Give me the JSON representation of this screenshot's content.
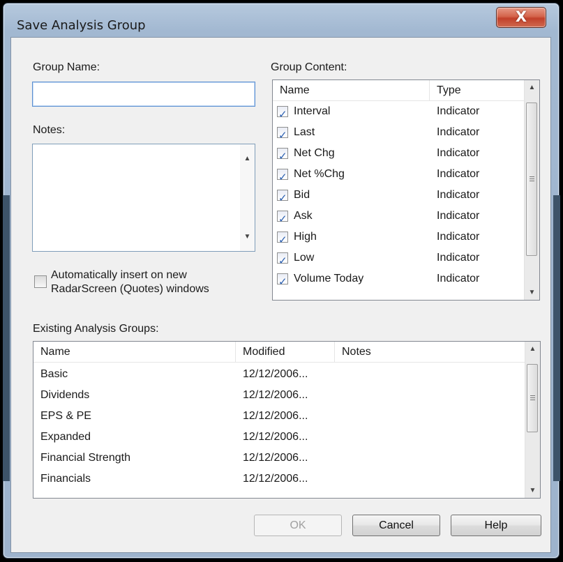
{
  "window": {
    "title": "Save Analysis Group",
    "close_label": "X"
  },
  "form": {
    "group_name_label": "Group Name:",
    "group_name_value": "",
    "notes_label": "Notes:",
    "notes_value": "",
    "auto_insert_line1": "Automatically insert on new",
    "auto_insert_line2": "RadarScreen (Quotes) windows",
    "auto_insert_checked": false
  },
  "group_content": {
    "label": "Group Content:",
    "columns": [
      "Name",
      "Type"
    ],
    "items": [
      {
        "name": "Interval",
        "type": "Indicator",
        "checked": true
      },
      {
        "name": "Last",
        "type": "Indicator",
        "checked": true
      },
      {
        "name": "Net Chg",
        "type": "Indicator",
        "checked": true
      },
      {
        "name": "Net %Chg",
        "type": "Indicator",
        "checked": true
      },
      {
        "name": "Bid",
        "type": "Indicator",
        "checked": true
      },
      {
        "name": "Ask",
        "type": "Indicator",
        "checked": true
      },
      {
        "name": "High",
        "type": "Indicator",
        "checked": true
      },
      {
        "name": "Low",
        "type": "Indicator",
        "checked": true
      },
      {
        "name": "Volume Today",
        "type": "Indicator",
        "checked": true
      }
    ]
  },
  "existing_groups": {
    "label": "Existing Analysis Groups:",
    "columns": [
      "Name",
      "Modified",
      "Notes"
    ],
    "rows": [
      {
        "name": "Basic",
        "modified": "12/12/2006...",
        "notes": ""
      },
      {
        "name": "Dividends",
        "modified": "12/12/2006...",
        "notes": ""
      },
      {
        "name": "EPS & PE",
        "modified": "12/12/2006...",
        "notes": ""
      },
      {
        "name": "Expanded",
        "modified": "12/12/2006...",
        "notes": ""
      },
      {
        "name": "Financial Strength",
        "modified": "12/12/2006...",
        "notes": ""
      },
      {
        "name": "Financials",
        "modified": "12/12/2006...",
        "notes": ""
      }
    ]
  },
  "buttons": {
    "ok": "OK",
    "cancel": "Cancel",
    "help": "Help"
  },
  "icons": {
    "scroll_up": "scroll-up-arrow",
    "scroll_down": "scroll-down-arrow",
    "checkmark": "checkmark",
    "close": "close-x"
  },
  "colors": {
    "close_button": "#c2402a",
    "checkmark": "#2a5fb0",
    "frame": "#a2b8d1"
  }
}
